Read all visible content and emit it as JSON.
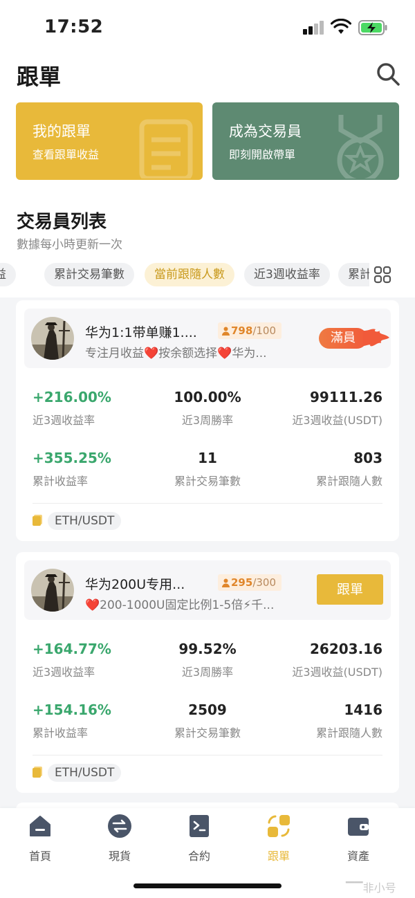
{
  "status_bar": {
    "time": "17:52"
  },
  "header": {
    "title": "跟單"
  },
  "promos": [
    {
      "title": "我的跟單",
      "subtitle": "查看跟單收益",
      "color": "#e8b93a"
    },
    {
      "title": "成為交易員",
      "subtitle": "即刻開啟帶單",
      "color": "#5e8a72"
    }
  ],
  "section": {
    "title": "交易員列表",
    "subtitle": "數據每小時更新一次"
  },
  "filters": [
    {
      "label": "益",
      "active": false
    },
    {
      "label": "累計交易筆數",
      "active": false
    },
    {
      "label": "當前跟隨人數",
      "active": true
    },
    {
      "label": "近3週收益率",
      "active": false
    },
    {
      "label": "累計",
      "active": false
    }
  ],
  "traders": [
    {
      "name": "华为1:1带单赚1....",
      "followers": "798",
      "followers_max": "/100",
      "description": "专注月收益❤️按余额选择❤️华为...",
      "action": "滿員",
      "stats": [
        {
          "value": "+216.00%",
          "label": "近3週收益率"
        },
        {
          "value": "100.00%",
          "label": "近3周勝率"
        },
        {
          "value": "99111.26",
          "label": "近3週收益(USDT)"
        },
        {
          "value": "+355.25%",
          "label": "累計收益率"
        },
        {
          "value": "11",
          "label": "累計交易筆數"
        },
        {
          "value": "803",
          "label": "累計跟隨人數"
        }
      ],
      "pair": "ETH/USDT"
    },
    {
      "name": "华为200U专用...",
      "followers": "295",
      "followers_max": "/300",
      "description": "❤️200-1000U固定比例1-5倍⚡千...",
      "action": "跟單",
      "stats": [
        {
          "value": "+164.77%",
          "label": "近3週收益率"
        },
        {
          "value": "99.52%",
          "label": "近3周勝率"
        },
        {
          "value": "26203.16",
          "label": "近3週收益(USDT)"
        },
        {
          "value": "+154.16%",
          "label": "累計收益率"
        },
        {
          "value": "2509",
          "label": "累計交易筆數"
        },
        {
          "value": "1416",
          "label": "累計跟隨人數"
        }
      ],
      "pair": "ETH/USDT"
    }
  ],
  "bottom_nav": [
    {
      "label": "首頁",
      "icon": "home-icon"
    },
    {
      "label": "現貨",
      "icon": "spot-exchange-icon"
    },
    {
      "label": "合約",
      "icon": "contract-icon"
    },
    {
      "label": "跟單",
      "icon": "copy-trade-icon",
      "active": true
    },
    {
      "label": "資產",
      "icon": "wallet-icon"
    }
  ],
  "watermark": "非小号",
  "colors": {
    "accent": "#e8b93a",
    "positive": "#3aa76d",
    "full": "#f15a3a",
    "promo_green": "#5e8a72"
  }
}
